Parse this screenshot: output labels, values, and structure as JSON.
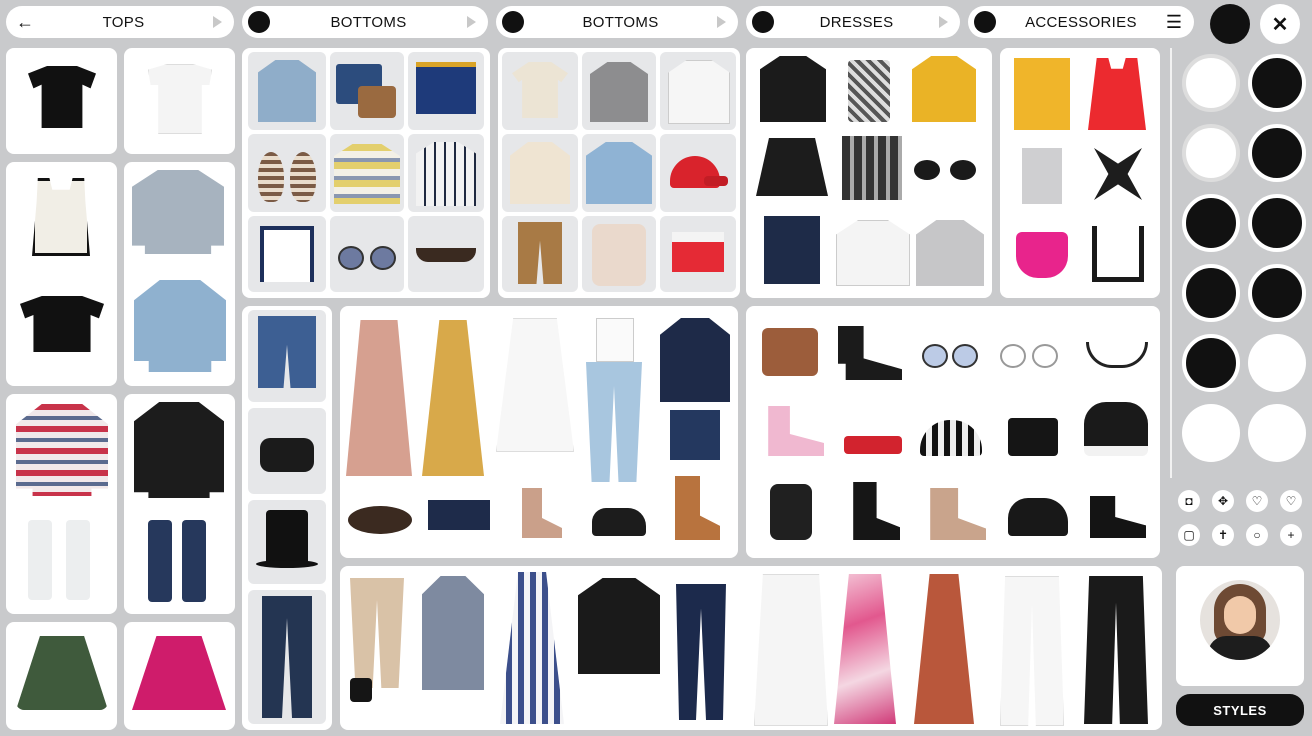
{
  "tabs": [
    {
      "label": "TOPS",
      "icon": "arrow-left-icon",
      "trailing": "triangle-right-icon"
    },
    {
      "label": "BOTTOMS",
      "icon": "dot-icon",
      "trailing": "triangle-right-icon"
    },
    {
      "label": "BOTTOMS",
      "icon": "dot-icon",
      "trailing": "triangle-right-icon"
    },
    {
      "label": "DRESSES",
      "icon": "dot-icon",
      "trailing": "triangle-right-icon"
    },
    {
      "label": "ACCESSORIES",
      "icon": "dot-icon",
      "trailing": "menu-icon"
    }
  ],
  "top_right": {
    "close_symbol": "✕"
  },
  "glyphs": {
    "back": "←",
    "menu": "☰"
  },
  "tool_glyphs": [
    "◘",
    "✥",
    "♡",
    "♡",
    "▢",
    "✝",
    "○",
    "+"
  ],
  "styles_button": {
    "label": "STYLES"
  },
  "colors": {
    "background": "#c9cacc",
    "card": "#ffffff",
    "accent_dark": "#111111"
  }
}
